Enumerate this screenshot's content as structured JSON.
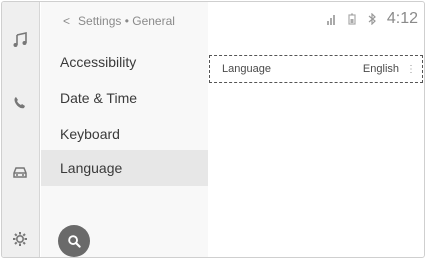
{
  "header": {
    "breadcrumb": "Settings • General",
    "clock": "4:12"
  },
  "rail": {
    "icons": [
      "music-note-icon",
      "phone-icon",
      "car-icon",
      "gear-icon"
    ]
  },
  "menu": {
    "items": [
      {
        "label": "Accessibility"
      },
      {
        "label": "Date & Time"
      },
      {
        "label": "Keyboard"
      },
      {
        "label": "Language",
        "selected": true
      }
    ]
  },
  "detail": {
    "language_row": {
      "label": "Language",
      "value": "English"
    }
  },
  "status_icons": [
    "signal-icon",
    "battery-icon",
    "bluetooth-icon"
  ]
}
